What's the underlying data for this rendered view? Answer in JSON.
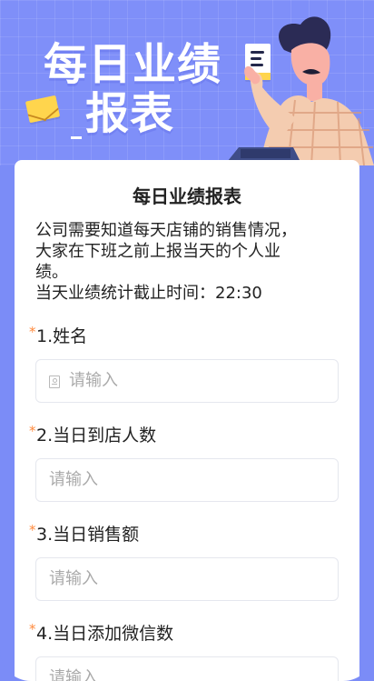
{
  "hero": {
    "title_line1": "每日业绩",
    "title_line2": "报表",
    "icons": [
      "envelope-icon",
      "document-icon",
      "person-illustration",
      "laptop-icon"
    ]
  },
  "form": {
    "title": "每日业绩报表",
    "intro_line1": "公司需要知道每天店铺的销售情况，",
    "intro_line2": "大家在下班之前上报当天的个人业",
    "intro_line3": "绩。",
    "intro_line4": "当天业绩统计截止时间：22:30",
    "fields": [
      {
        "required_mark": "*",
        "label": "1.姓名",
        "placeholder": "请输入",
        "value": "",
        "icon": "user-card-icon"
      },
      {
        "required_mark": "*",
        "label": "2.当日到店人数",
        "placeholder": "请输入",
        "value": ""
      },
      {
        "required_mark": "*",
        "label": "3.当日销售额",
        "placeholder": "请输入",
        "value": ""
      },
      {
        "required_mark": "*",
        "label": "4.当日添加微信数",
        "placeholder": "请输入",
        "value": ""
      }
    ]
  },
  "colors": {
    "background": "#7b8cf7",
    "card": "#ffffff",
    "required": "#ff8a3d",
    "text": "#222222",
    "placeholder": "#aaaaaa",
    "input_border": "#e5e7ee"
  }
}
